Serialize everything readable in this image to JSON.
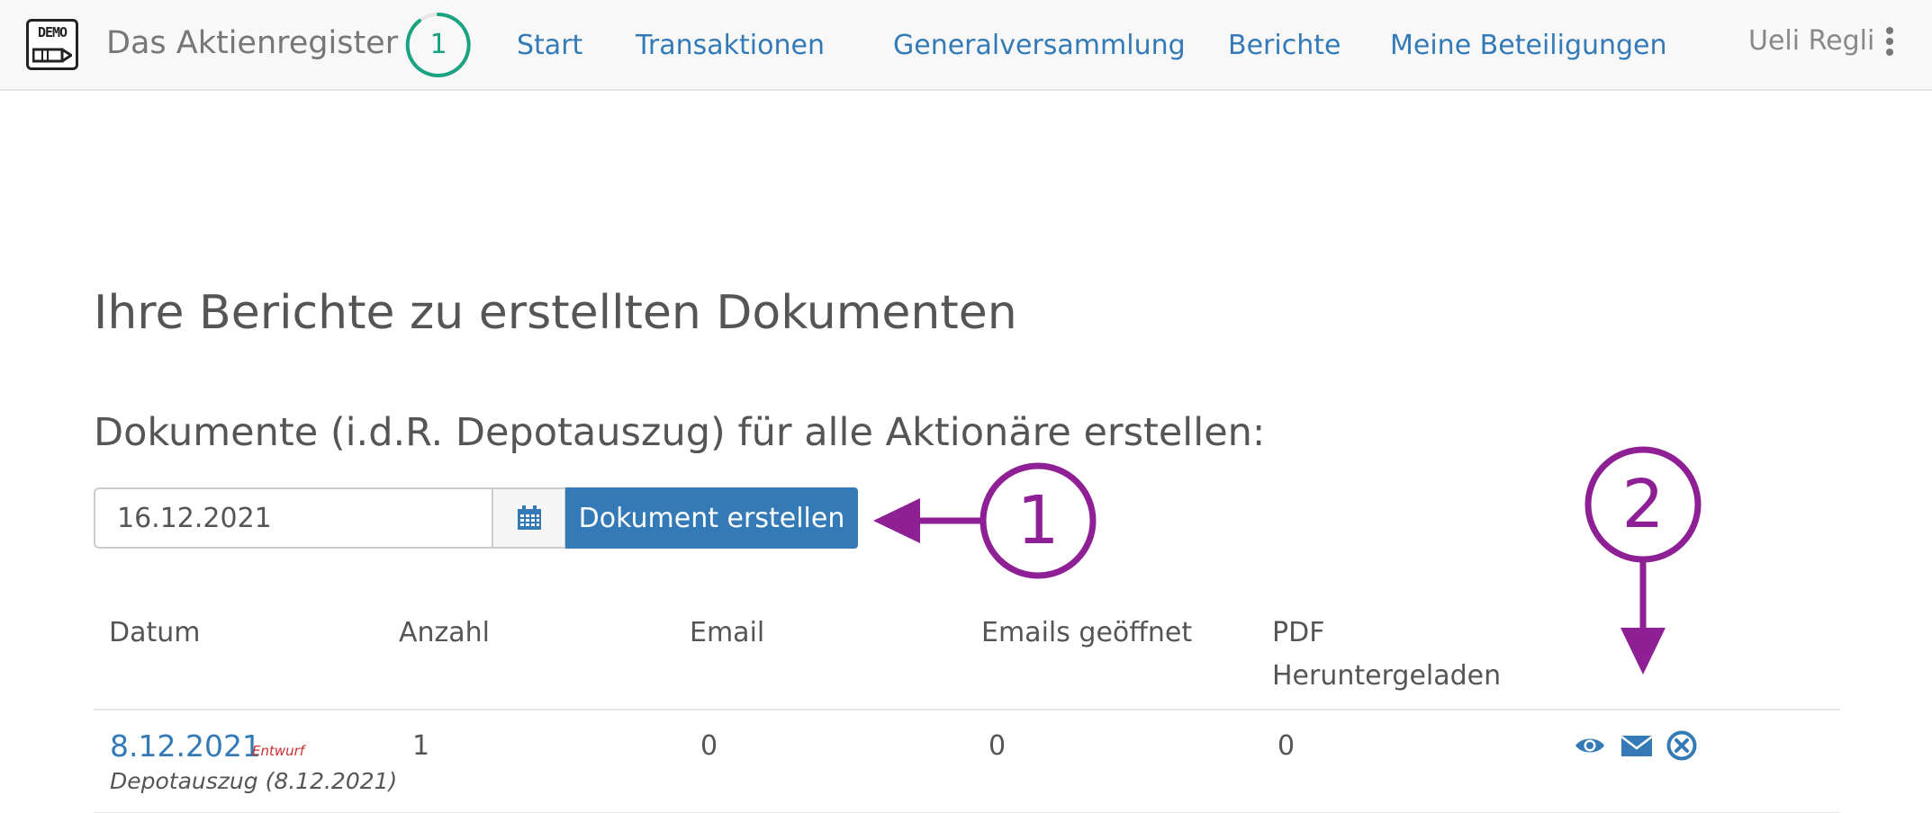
{
  "app": {
    "logo_text": "DEMO",
    "title": "Das Aktienregister",
    "badge_count": "1"
  },
  "nav": {
    "items": [
      "Start",
      "Transaktionen",
      "Generalversammlung",
      "Berichte",
      "Meine Beteiligungen"
    ]
  },
  "user": {
    "name": "Ueli Regli"
  },
  "page": {
    "title": "Ihre Berichte zu erstellten Dokumenten",
    "subtitle": "Dokumente (i.d.R. Depotauszug) für alle Aktionäre erstellen:"
  },
  "form": {
    "date_value": "16.12.2021",
    "create_label": "Dokument erstellen"
  },
  "table": {
    "headers": [
      "Datum",
      "Anzahl",
      "Email",
      "Emails geöffnet",
      "PDF Heruntergeladen"
    ],
    "rows": [
      {
        "date": "8.12.2021",
        "status": "Entwurf",
        "document": "Depotauszug (8.12.2021)",
        "count": "1",
        "email": "0",
        "emails_opened": "0",
        "pdf_downloaded": "0",
        "actions": [
          "eye-icon",
          "envelope-icon",
          "remove-circle-icon"
        ]
      }
    ]
  },
  "annotations": {
    "markers": [
      "1",
      "2"
    ],
    "color": "#8e1f95"
  },
  "colors": {
    "link": "#337ab7",
    "primary_button": "#337ab7",
    "badge": "#1aa383",
    "draft": "#c9302c"
  }
}
